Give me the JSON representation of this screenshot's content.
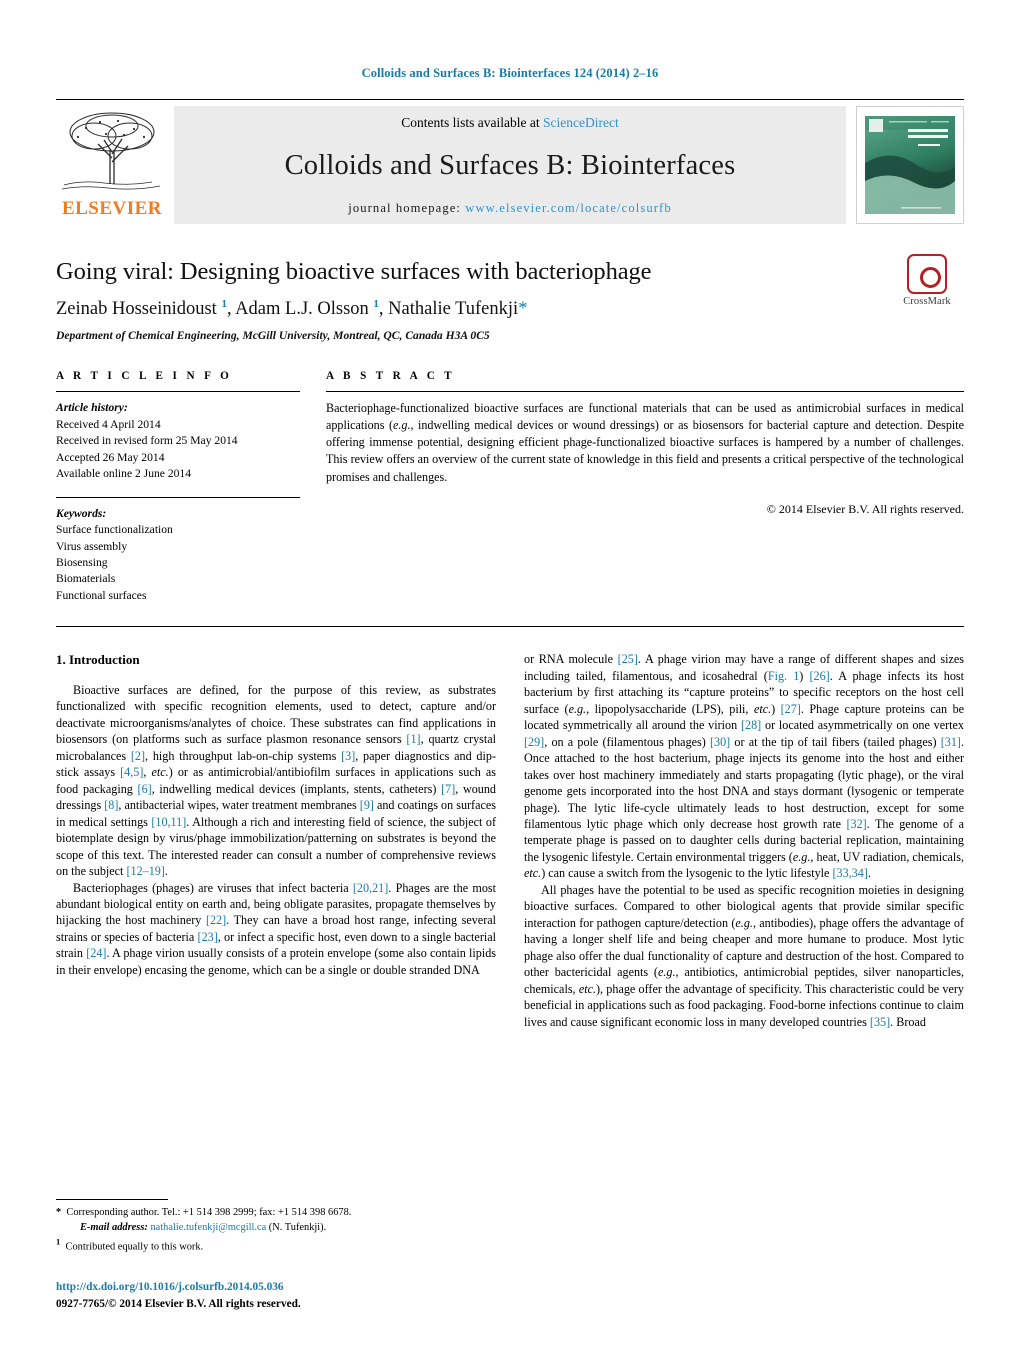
{
  "running_head": "Colloids and Surfaces B: Biointerfaces 124 (2014) 2–16",
  "banner": {
    "publisher_name": "ELSEVIER",
    "contents_prefix": "Contents lists available at ",
    "contents_link": "ScienceDirect",
    "journal_name": "Colloids and Surfaces B: Biointerfaces",
    "homepage_label": "journal homepage:",
    "homepage_url": "www.elsevier.com/locate/colsurfb",
    "cover_title": "COLLOIDS AND SURFACES B"
  },
  "crossmark": {
    "label": "CrossMark"
  },
  "article": {
    "title": "Going viral: Designing bioactive surfaces with bacteriophage",
    "authors_html": "Zeinab Hosseinidoust <sup>1</sup>, Adam L.J. Olsson <sup>1</sup>, Nathalie Tufenkji<span class=\"star\">*</span>",
    "affiliation": "Department of Chemical Engineering, McGill University, Montreal, QC, Canada H3A 0C5"
  },
  "info": {
    "heading": "A R T I C L E  I N F O",
    "history_label": "Article history:",
    "history": [
      "Received 4 April 2014",
      "Received in revised form 25 May 2014",
      "Accepted 26 May 2014",
      "Available online 2 June 2014"
    ],
    "keywords_label": "Keywords:",
    "keywords": [
      "Surface functionalization",
      "Virus assembly",
      "Biosensing",
      "Biomaterials",
      "Functional surfaces"
    ]
  },
  "abstract": {
    "heading": "A B S T R A C T",
    "text_html": "Bacteriophage-functionalized bioactive surfaces are functional materials that can be used as antimicrobial surfaces in medical applications (<i>e.g.</i>, indwelling medical devices or wound dressings) or as biosensors for bacterial capture and detection. Despite offering immense potential, designing efficient phage-functionalized bioactive surfaces is hampered by a number of challenges. This review offers an overview of the current state of knowledge in this field and presents a critical perspective of the technological promises and challenges.",
    "copyright": "© 2014 Elsevier B.V. All rights reserved."
  },
  "body": {
    "section_title": "1.  Introduction",
    "left_paragraphs_html": [
      "Bioactive surfaces are defined, for the purpose of this review, as substrates functionalized with specific recognition elements, used to detect, capture and/or deactivate microorganisms/analytes of choice. These substrates can find applications in biosensors (on platforms such as surface plasmon resonance sensors <span class=\"ref\">[1]</span>, quartz crystal microbalances <span class=\"ref\">[2]</span>, high throughput lab-on-chip systems <span class=\"ref\">[3]</span>, paper diagnostics and dip-stick assays <span class=\"ref\">[4,5]</span>, <i>etc.</i>) or as antimicrobial/antibiofilm surfaces in applications such as food packaging <span class=\"ref\">[6]</span>, indwelling medical devices (implants, stents, catheters) <span class=\"ref\">[7]</span>, wound dressings <span class=\"ref\">[8]</span>, antibacterial wipes, water treatment membranes <span class=\"ref\">[9]</span> and coatings on surfaces in medical settings <span class=\"ref\">[10,11]</span>. Although a rich and interesting field of science, the subject of biotemplate design by virus/phage immobilization/patterning on substrates is beyond the scope of this text. The interested reader can consult a number of comprehensive reviews on the subject <span class=\"ref\">[12–19]</span>.",
      "Bacteriophages (phages) are viruses that infect bacteria <span class=\"ref\">[20,21]</span>. Phages are the most abundant biological entity on earth and, being obligate parasites, propagate themselves by hijacking the host machinery <span class=\"ref\">[22]</span>. They can have a broad host range, infecting several strains or species of bacteria <span class=\"ref\">[23]</span>, or infect a specific host, even down to a single bacterial strain <span class=\"ref\">[24]</span>. A phage virion usually consists of a protein envelope (some also contain lipids in their envelope) encasing the genome, which can be a single or double stranded DNA"
    ],
    "right_paragraphs_html": [
      "or RNA molecule <span class=\"ref\">[25]</span>. A phage virion may have a range of different shapes and sizes including tailed, filamentous, and icosahedral (<span class=\"ref\">Fig. 1</span>) <span class=\"ref\">[26]</span>. A phage infects its host bacterium by first attaching its &#8220;capture proteins&#8221; to specific receptors on the host cell surface (<i>e.g.</i>, lipopolysaccharide (LPS), pili, <i>etc.</i>) <span class=\"ref\">[27]</span>. Phage capture proteins can be located symmetrically all around the virion <span class=\"ref\">[28]</span> or located asymmetrically on one vertex <span class=\"ref\">[29]</span>, on a pole (filamentous phages) <span class=\"ref\">[30]</span> or at the tip of tail fibers (tailed phages) <span class=\"ref\">[31]</span>. Once attached to the host bacterium, phage injects its genome into the host and either takes over host machinery immediately and starts propagating (lytic phage), or the viral genome gets incorporated into the host DNA and stays dormant (lysogenic or temperate phage). The lytic life-cycle ultimately leads to host destruction, except for some filamentous lytic phage which only decrease host growth rate <span class=\"ref\">[32]</span>. The genome of a temperate phage is passed on to daughter cells during bacterial replication, maintaining the lysogenic lifestyle. Certain environmental triggers (<i>e.g.</i>, heat, UV radiation, chemicals, <i>etc.</i>) can cause a switch from the lysogenic to the lytic lifestyle <span class=\"ref\">[33,34]</span>.",
      "All phages have the potential to be used as specific recognition moieties in designing bioactive surfaces. Compared to other biological agents that provide similar specific interaction for pathogen capture/detection (<i>e.g.</i>, antibodies), phage offers the advantage of having a longer shelf life and being cheaper and more humane to produce. Most lytic phage also offer the dual functionality of capture and destruction of the host. Compared to other bactericidal agents (<i>e.g.</i>, antibiotics, antimicrobial peptides, silver nanoparticles, chemicals, <i>etc.</i>), phage offer the advantage of specificity. This characteristic could be very beneficial in applications such as food packaging. Food-borne infections continue to claim lives and cause significant economic loss in many developed countries <span class=\"ref\">[35]</span>. Broad"
    ]
  },
  "footnotes": {
    "corresponding_html": "<span class=\"mk\">*</span>&nbsp; Corresponding author. Tel.: +1 514 398 2999; fax: +1 514 398 6678.",
    "email_html": "<span class=\"em\">E-mail address:</span> <span class=\"link\">nathalie.tufenkji@mcgill.ca</span> (N. Tufenkji).",
    "equal_contrib_html": "<span class=\"mk\"><sup>1</sup></span>&nbsp; Contributed equally to this work."
  },
  "footer": {
    "doi": "http://dx.doi.org/10.1016/j.colsurfb.2014.05.036",
    "issn_line": "0927-7765/© 2014 Elsevier B.V. All rights reserved."
  }
}
